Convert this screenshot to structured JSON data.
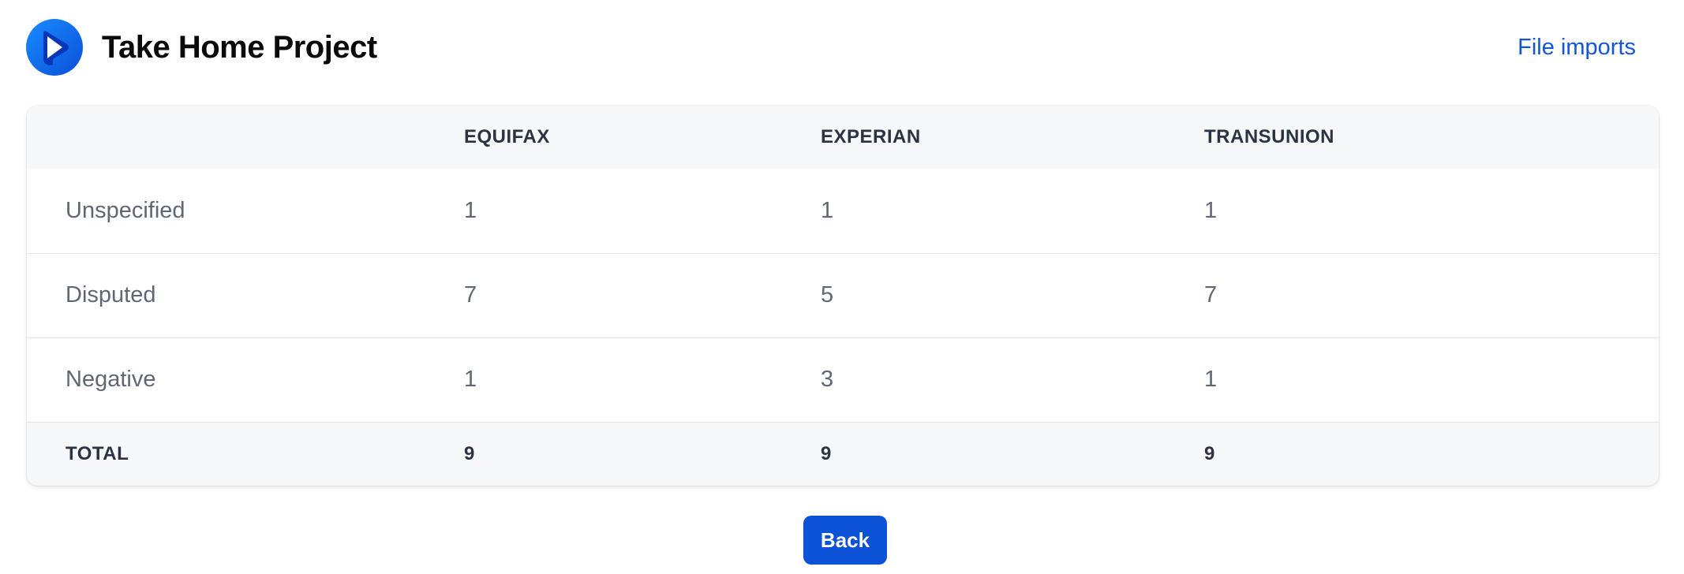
{
  "header": {
    "title": "Take Home Project",
    "nav_link": "File imports",
    "logo_icon": "play-icon"
  },
  "colors": {
    "accent": "#0b52d6",
    "link": "#1356d4",
    "header_bg": "#f6f7f9"
  },
  "table": {
    "columns": [
      "",
      "EQUIFAX",
      "EXPERIAN",
      "TRANSUNION"
    ],
    "rows": [
      {
        "label": "Unspecified",
        "equifax": "1",
        "experian": "1",
        "transunion": "1"
      },
      {
        "label": "Disputed",
        "equifax": "7",
        "experian": "5",
        "transunion": "7"
      },
      {
        "label": "Negative",
        "equifax": "1",
        "experian": "3",
        "transunion": "1"
      }
    ],
    "total": {
      "label": "TOTAL",
      "equifax": "9",
      "experian": "9",
      "transunion": "9"
    }
  },
  "actions": {
    "back_label": "Back"
  }
}
